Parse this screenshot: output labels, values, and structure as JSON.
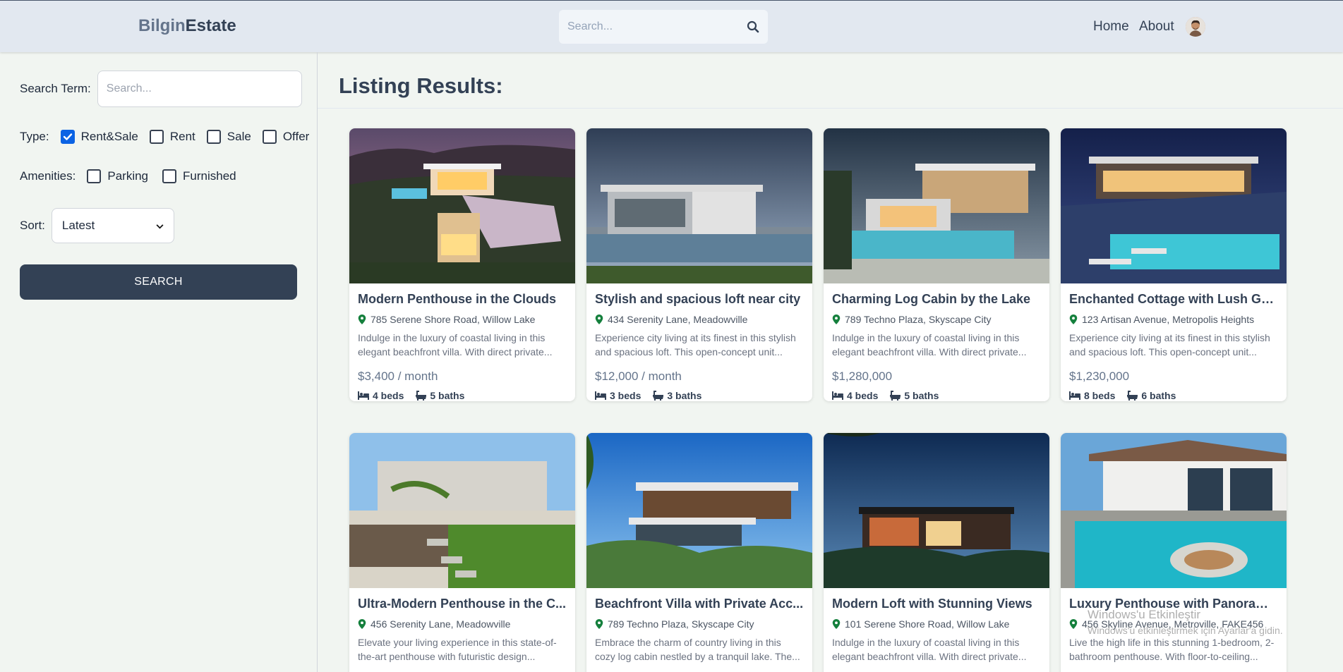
{
  "header": {
    "logo_part1": "Bilgin",
    "logo_part2": "Estate",
    "search_placeholder": "Search...",
    "nav": [
      "Home",
      "About"
    ]
  },
  "sidebar": {
    "search_term_label": "Search Term:",
    "search_term_placeholder": "Search...",
    "type_label": "Type:",
    "types": [
      {
        "label": "Rent&Sale",
        "checked": true
      },
      {
        "label": "Rent",
        "checked": false
      },
      {
        "label": "Sale",
        "checked": false
      },
      {
        "label": "Offer",
        "checked": false
      }
    ],
    "amenities_label": "Amenities:",
    "amenities": [
      {
        "label": "Parking",
        "checked": false
      },
      {
        "label": "Furnished",
        "checked": false
      }
    ],
    "sort_label": "Sort:",
    "sort_value": "Latest",
    "search_button": "SEARCH"
  },
  "main": {
    "title": "Listing Results:",
    "listings": [
      {
        "title": "Modern Penthouse in the Clouds",
        "address": "785 Serene Shore Road, Willow Lake",
        "description": "Indulge in the luxury of coastal living in this elegant beachfront villa. With direct private...",
        "price": "$3,400 / month",
        "beds": "4 beds",
        "baths": "5 baths"
      },
      {
        "title": "Stylish and spacious loft near city",
        "address": "434 Serenity Lane, Meadowville",
        "description": "Experience city living at its finest in this stylish and spacious loft. This open-concept unit...",
        "price": "$12,000 / month",
        "beds": "3 beds",
        "baths": "3 baths"
      },
      {
        "title": "Charming Log Cabin by the Lake",
        "address": "789 Techno Plaza, Skyscape City",
        "description": "Indulge in the luxury of coastal living in this elegant beachfront villa. With direct private...",
        "price": "$1,280,000",
        "beds": "4 beds",
        "baths": "5 baths"
      },
      {
        "title": "Enchanted Cottage with Lush Gar...",
        "address": "123 Artisan Avenue, Metropolis Heights",
        "description": "Experience city living at its finest in this stylish and spacious loft. This open-concept unit...",
        "price": "$1,230,000",
        "beds": "8 beds",
        "baths": "6 baths"
      },
      {
        "title": "Ultra-Modern Penthouse in the C...",
        "address": "456 Serenity Lane, Meadowville",
        "description": "Elevate your living experience in this state-of-the-art penthouse with futuristic design...",
        "price": "",
        "beds": "",
        "baths": ""
      },
      {
        "title": "Beachfront Villa with Private Acc...",
        "address": "789 Techno Plaza, Skyscape City",
        "description": "Embrace the charm of country living in this cozy log cabin nestled by a tranquil lake. The...",
        "price": "",
        "beds": "",
        "baths": ""
      },
      {
        "title": "Modern Loft with Stunning Views",
        "address": "101 Serene Shore Road, Willow Lake",
        "description": "Indulge in the luxury of coastal living in this elegant beachfront villa. With direct private...",
        "price": "",
        "beds": "",
        "baths": ""
      },
      {
        "title": "Luxury Penthouse with Panorami...",
        "address": "456 Skyline Avenue, Metroville, FAKE456",
        "description": "Live the high life in this stunning 1-bedroom, 2-bathroom penthouse. With floor-to-ceiling...",
        "price": "",
        "beds": "",
        "baths": ""
      }
    ]
  },
  "watermark": {
    "line1": "Windows'u Etkinleştir",
    "line2": "Windows'u etkinleştirmek için Ayarlar'a gidin."
  }
}
